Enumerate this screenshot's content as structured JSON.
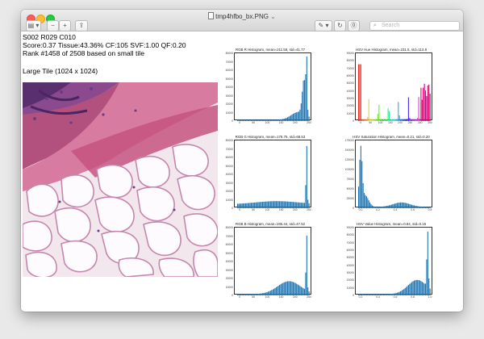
{
  "window": {
    "title": "tmp4hfbo_bx.PNG",
    "title_chevron": "⌄",
    "search_placeholder": "Search",
    "toolbar": {
      "sidebar_glyph": "▤ ▾",
      "zoom_out_glyph": "−",
      "zoom_in_glyph": "+",
      "share_glyph": "⇪",
      "markup_glyph": "✎ ▾",
      "rotate_glyph": "↻",
      "annotate_glyph": "⓪"
    }
  },
  "header": {
    "line1": "S002 R029 C010",
    "line2": "Score:0.37 Tissue:43.36% CF:105 SVF:1.00 QF:0.20",
    "line3": "Rank #1458 of 2508 based on small tile",
    "tile_label": "Large Tile (1024 x 1024)"
  },
  "chart_data": [
    {
      "type": "bar",
      "title": "RGB R Histogram, mean=211.58, std=41.77",
      "xlim": [
        0,
        255
      ],
      "ylim": [
        0,
        80000
      ],
      "xticks": [
        "0",
        "50",
        "100",
        "150",
        "200",
        "250"
      ],
      "yticks": [
        "0",
        "10000",
        "20000",
        "30000",
        "40000",
        "50000",
        "60000",
        "70000",
        "80000"
      ],
      "color": "#1f77b4",
      "shape": "Low flat tail at 0–180, gently rising from 180 to 240, sharp peak near 248 (about 73000)"
    },
    {
      "type": "bar",
      "title": "HSV Hue Histogram, mean=231.5, std=113.8",
      "xlim": [
        0,
        360
      ],
      "ylim": [
        0,
        90000
      ],
      "xticks": [
        "0",
        "50",
        "100",
        "150",
        "200",
        "250",
        "300",
        "350"
      ],
      "yticks": [
        "0",
        "10000",
        "20000",
        "30000",
        "40000",
        "50000",
        "60000",
        "70000",
        "80000",
        "90000"
      ],
      "color": "#d62728",
      "shape": "Sparse hue-coloured spikes across the full range; tall spike near 0 (about 78000); dense magenta/red mass at 320–360"
    },
    {
      "type": "bar",
      "title": "RGB G Histogram, mean=178.75, std=68.53",
      "xlim": [
        0,
        255
      ],
      "ylim": [
        0,
        80000
      ],
      "xticks": [
        "0",
        "50",
        "100",
        "150",
        "200",
        "250"
      ],
      "yticks": [
        "0",
        "10000",
        "20000",
        "30000",
        "40000",
        "50000",
        "60000",
        "70000",
        "80000"
      ],
      "color": "#1f77b4",
      "shape": "Low plateau from 20 to 220, sharp peak near 248 (about 76000)"
    },
    {
      "type": "bar",
      "title": "HSV Saturation Histogram, mean=0.21, std=0.20",
      "xlim": [
        0,
        0.8
      ],
      "ylim": [
        0,
        175000
      ],
      "xticks": [
        "0.0",
        "0.2",
        "0.4",
        "0.6",
        "0.8"
      ],
      "yticks": [
        "0",
        "25000",
        "50000",
        "75000",
        "100000",
        "125000",
        "150000",
        "175000"
      ],
      "color": "#1f77b4",
      "shape": "Tall spike at about 0.02 (about 150000), fast decay, small hump from 0.3 to 0.55"
    },
    {
      "type": "bar",
      "title": "RGB B Histogram, mean=195.44, std=47.52",
      "xlim": [
        0,
        255
      ],
      "ylim": [
        0,
        80000
      ],
      "xticks": [
        "0",
        "50",
        "100",
        "150",
        "200",
        "250"
      ],
      "yticks": [
        "0",
        "10000",
        "20000",
        "30000",
        "40000",
        "50000",
        "60000",
        "70000",
        "80000"
      ],
      "color": "#1f77b4",
      "shape": "Broad hump from 100 to 240 (about 12000–18000), sharp peak near 248 (about 72000)"
    },
    {
      "type": "bar",
      "title": "HSV Value Histogram, mean=0.84, std=0.15",
      "xlim": [
        0,
        1.0
      ],
      "ylim": [
        0,
        90000
      ],
      "xticks": [
        "0.2",
        "0.4",
        "0.6",
        "0.8",
        "1.0"
      ],
      "yticks": [
        "0",
        "10000",
        "20000",
        "30000",
        "40000",
        "50000",
        "60000",
        "70000",
        "80000",
        "90000"
      ],
      "color": "#1f77b4",
      "shape": "Broad rise from 0.5 to 0.9, sharp peak near 0.97 (about 80000)"
    }
  ]
}
